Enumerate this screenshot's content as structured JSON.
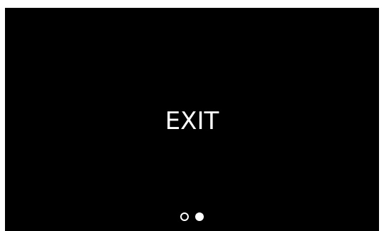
{
  "screen": {
    "label": "EXIT"
  },
  "pager": {
    "page_count": 2,
    "current_page": 2
  },
  "colors": {
    "screen_background": "#000000",
    "text": "#ffffff",
    "outer_background": "#ffffff"
  }
}
